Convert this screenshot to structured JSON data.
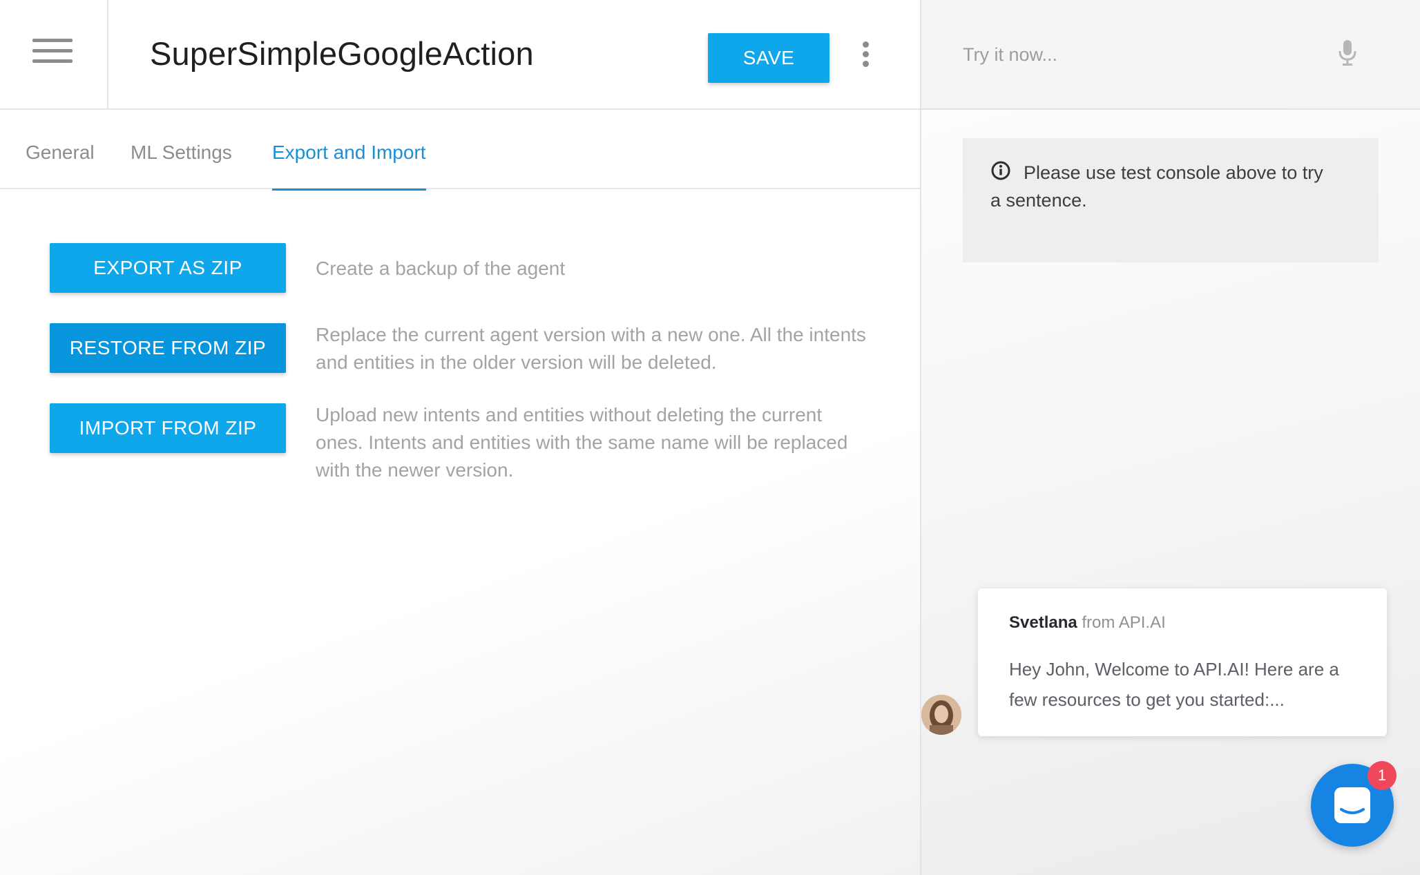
{
  "header": {
    "agent_name": "SuperSimpleGoogleAction",
    "save_label": "SAVE"
  },
  "tabs": [
    {
      "label": "General",
      "active": false
    },
    {
      "label": "ML Settings",
      "active": false
    },
    {
      "label": "Export and Import",
      "active": true
    }
  ],
  "actions": [
    {
      "button_label": "EXPORT AS ZIP",
      "description": "Create a backup of the agent"
    },
    {
      "button_label": "RESTORE FROM ZIP",
      "description": "Replace the current agent version with a new one. All the intents and entities in the older version will be deleted."
    },
    {
      "button_label": "IMPORT FROM ZIP",
      "description": "Upload new intents and entities without deleting the current ones. Intents and entities with the same name will be replaced with the newer version."
    }
  ],
  "console": {
    "placeholder": "Try it now...",
    "info_text": "Please use test console above to try a sentence."
  },
  "chat": {
    "sender_name": "Svetlana",
    "sender_org": "from API.AI",
    "message": "Hey John, Welcome to API.AI! Here are a few resources to get you started:...",
    "badge_count": "1"
  },
  "colors": {
    "accent": "#0ea7ec",
    "active_tab": "#1b8fd6",
    "launcher": "#1684e2",
    "badge": "#f0475b"
  },
  "icons": [
    "hamburger-icon",
    "kebab-menu-icon",
    "microphone-icon",
    "info-icon",
    "chat-icon"
  ]
}
